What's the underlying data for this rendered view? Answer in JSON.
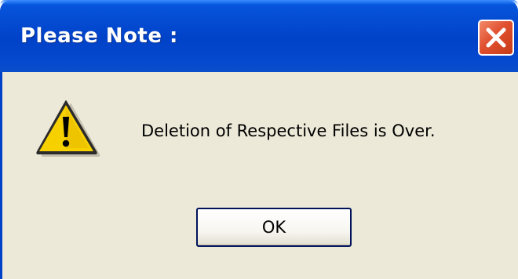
{
  "window": {
    "title": "Please Note :",
    "close_icon": "close-icon",
    "colors": {
      "titlebar": "#0042c8",
      "body": "#ece9d8",
      "close_button": "#e0502f"
    }
  },
  "content": {
    "icon": "warning-icon",
    "message": "Deletion of Respective Files is Over."
  },
  "buttons": {
    "ok_label": "OK"
  }
}
